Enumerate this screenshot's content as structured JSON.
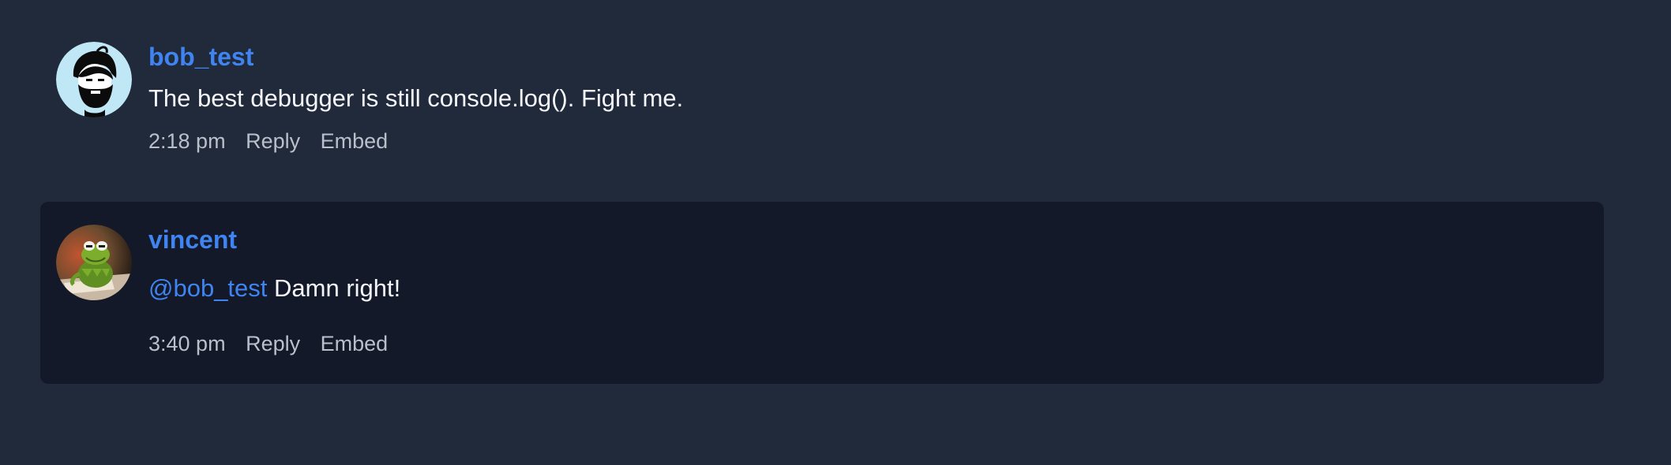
{
  "comments": [
    {
      "username": "bob_test",
      "text": "The best debugger is still console.log(). Fight me.",
      "time": "2:18 pm",
      "reply_label": "Reply",
      "embed_label": "Embed",
      "avatar_bg": "#bfe7f6"
    },
    {
      "username": "vincent",
      "mention": "@bob_test",
      "text": "Damn right!",
      "time": "3:40 pm",
      "reply_label": "Reply",
      "embed_label": "Embed",
      "avatar_bg": "#6b4b2f"
    }
  ],
  "colors": {
    "page_bg": "#212a3a",
    "highlight_bg": "#131928",
    "accent": "#3f84f0",
    "text": "#f4f6fa",
    "meta": "#b9c0cb"
  }
}
